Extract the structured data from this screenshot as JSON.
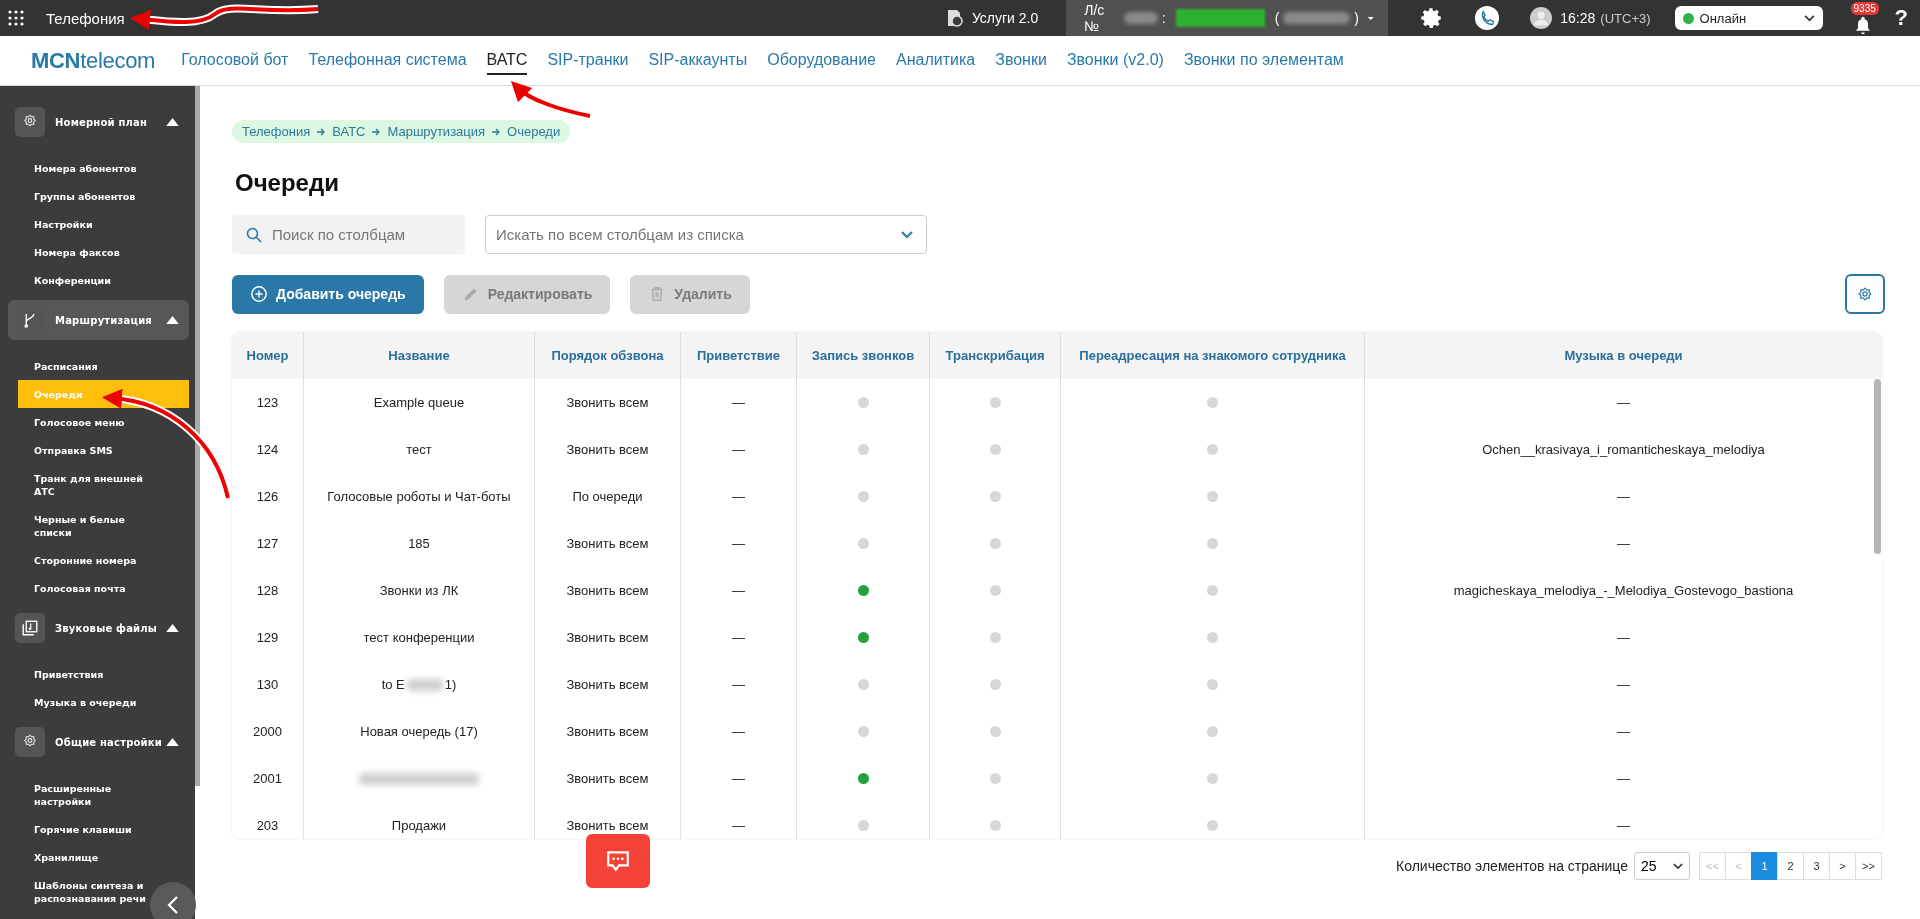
{
  "topbar": {
    "section": "Телефония",
    "services": "Услуги 2.0",
    "account_label": "Л/с №",
    "account_sep": ":",
    "account_open": "(",
    "account_close": ")",
    "time": "16:28",
    "timezone": "(UTC+3)",
    "status": {
      "label": "Онлайн",
      "color": "#2eb24a"
    },
    "notifications": "9335",
    "help": "?"
  },
  "nav": {
    "logo": "**MCN**telecom",
    "tabs": [
      {
        "label": "Голосовой бот",
        "selected": false
      },
      {
        "label": "Телефонная система",
        "selected": false
      },
      {
        "label": "ВАТС",
        "selected": true
      },
      {
        "label": "SIP-транки",
        "selected": false
      },
      {
        "label": "SIP-аккаунты",
        "selected": false
      },
      {
        "label": "Оборудование",
        "selected": false
      },
      {
        "label": "Аналитика",
        "selected": false
      },
      {
        "label": "Звонки",
        "selected": false
      },
      {
        "label": "Звонки (v2.0)",
        "selected": false
      },
      {
        "label": "Звонки по элементам",
        "selected": false
      }
    ]
  },
  "sidebar": {
    "groups": [
      {
        "title": "Номерной план",
        "expanded": true,
        "highlighted": false,
        "items": [
          {
            "label": "Номера абонентов",
            "selected": false
          },
          {
            "label": "Группы абонентов",
            "selected": false
          },
          {
            "label": "Настройки",
            "selected": false
          },
          {
            "label": "Номера факсов",
            "selected": false
          },
          {
            "label": "Конференции",
            "selected": false
          }
        ]
      },
      {
        "title": "Маршрутизация",
        "expanded": true,
        "highlighted": true,
        "items": [
          {
            "label": "Расписания",
            "selected": false
          },
          {
            "label": "Очереди",
            "selected": true
          },
          {
            "label": "Голосовое меню",
            "selected": false
          },
          {
            "label": "Отправка SMS",
            "selected": false
          },
          {
            "label": "Транк для внешней АТС",
            "selected": false
          },
          {
            "label": "Черные и белые списки",
            "selected": false
          },
          {
            "label": "Сторонние номера",
            "selected": false
          },
          {
            "label": "Голосовая почта",
            "selected": false
          }
        ]
      },
      {
        "title": "Звуковые файлы",
        "expanded": true,
        "highlighted": false,
        "items": [
          {
            "label": "Приветствия",
            "selected": false
          },
          {
            "label": "Музыка в очереди",
            "selected": false
          }
        ]
      },
      {
        "title": "Общие настройки",
        "expanded": true,
        "highlighted": false,
        "items": [
          {
            "label": "Расширенные настройки",
            "selected": false
          },
          {
            "label": "Горячие клавиши",
            "selected": false
          },
          {
            "label": "Хранилище",
            "selected": false
          },
          {
            "label": "Шаблоны синтеза и распознавания речи",
            "selected": false
          }
        ]
      }
    ]
  },
  "breadcrumb": [
    "Телефония",
    "ВАТС",
    "Маршрутизация",
    "Очереди"
  ],
  "title": "Очереди",
  "search": {
    "placeholder": "Поиск по столбцам"
  },
  "column_filter": {
    "placeholder": "Искать по всем столбцам из списка"
  },
  "actions": [
    {
      "label": "Добавить очередь",
      "disabled": false
    },
    {
      "label": "Редактировать",
      "disabled": true
    },
    {
      "label": "Удалить",
      "disabled": true
    }
  ],
  "table": {
    "columns": [
      "Номер",
      "Название",
      "Порядок обзвона",
      "Приветствие",
      "Запись звонков",
      "Транскрибация",
      "Переадресация на знакомого сотрудника",
      "Музыка в очереди"
    ],
    "rows": [
      {
        "number": "123",
        "name": "Example queue",
        "order": "Звонить всем",
        "greeting": "—",
        "recording": false,
        "transcription": false,
        "forwarding": false,
        "music": "—"
      },
      {
        "number": "124",
        "name": "тест",
        "order": "Звонить всем",
        "greeting": "—",
        "recording": false,
        "transcription": false,
        "forwarding": false,
        "music": "Ochen__krasivaya_i_romanticheskaya_melodiya"
      },
      {
        "number": "126",
        "name": "Голосовые роботы и Чат-боты",
        "order": "По очереди",
        "greeting": "—",
        "recording": false,
        "transcription": false,
        "forwarding": false,
        "music": "—"
      },
      {
        "number": "127",
        "name": "185",
        "order": "Звонить всем",
        "greeting": "—",
        "recording": false,
        "transcription": false,
        "forwarding": false,
        "music": "—"
      },
      {
        "number": "128",
        "name": "Звонки из ЛК",
        "order": "Звонить всем",
        "greeting": "—",
        "recording": true,
        "transcription": false,
        "forwarding": false,
        "music": "magicheskaya_melodiya_-_Melodiya_Gostevogo_bastiona"
      },
      {
        "number": "129",
        "name": "тест конференции",
        "order": "Звонить всем",
        "greeting": "—",
        "recording": true,
        "transcription": false,
        "forwarding": false,
        "music": "—"
      },
      {
        "number": "130",
        "name": "to Е",
        "name_end": "1)",
        "redacted": true,
        "order": "Звонить всем",
        "greeting": "—",
        "recording": false,
        "transcription": false,
        "forwarding": false,
        "music": "—"
      },
      {
        "number": "2000",
        "name": "Новая очередь (17)",
        "order": "Звонить всем",
        "greeting": "—",
        "recording": false,
        "transcription": false,
        "forwarding": false,
        "music": "—"
      },
      {
        "number": "2001",
        "redacted": true,
        "order": "Звонить всем",
        "greeting": "—",
        "recording": true,
        "transcription": false,
        "forwarding": false,
        "music": "—"
      },
      {
        "number": "203",
        "name": "Продажи",
        "order": "Звонить всем",
        "greeting": "—",
        "recording": false,
        "transcription": false,
        "forwarding": false,
        "music": "—"
      }
    ]
  },
  "pagination": {
    "label": "Количество элементов на странице",
    "page_size": "25",
    "pages": [
      {
        "label": "<<",
        "selected": false,
        "disabled": true
      },
      {
        "label": "<",
        "selected": false,
        "disabled": true
      },
      {
        "label": "1",
        "selected": true,
        "disabled": false
      },
      {
        "label": "2",
        "selected": false,
        "disabled": false
      },
      {
        "label": "3",
        "selected": false,
        "disabled": false
      },
      {
        "label": ">",
        "selected": false,
        "disabled": false
      },
      {
        "label": ">>",
        "selected": false,
        "disabled": false
      }
    ]
  }
}
